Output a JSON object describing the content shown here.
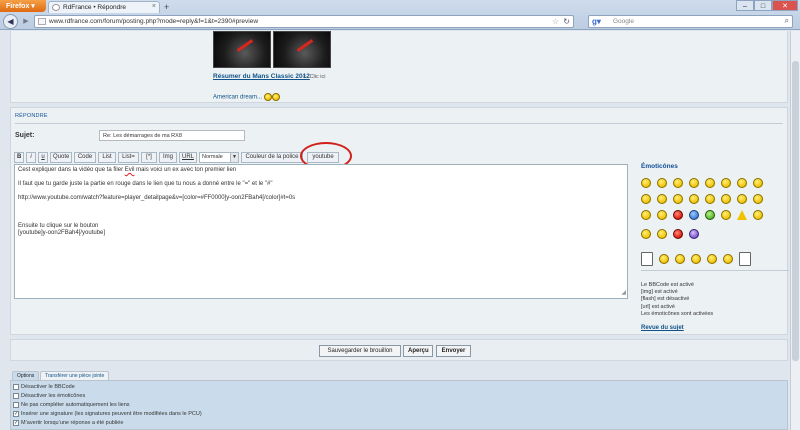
{
  "browser": {
    "app_button": "Firefox",
    "tab_title": "RdFrance • Répondre",
    "url": "www.rdfrance.com/forum/posting.php?mode=reply&f=1&t=2390#preview",
    "search_placeholder": "Google"
  },
  "preview": {
    "link_text": "Résumer du Mans Classic 2012",
    "credit": "<- Clic ici",
    "line2": "American dream..."
  },
  "reply": {
    "panel_title": "RÉPONDRE",
    "subject_label": "Sujet:",
    "subject_value": "Re: Les démarrages de ma RX8"
  },
  "toolbar": {
    "bold": "B",
    "italic": "i",
    "underline": "u",
    "quote": "Quote",
    "code": "Code",
    "list": "List",
    "list_ordered": "List=",
    "list_item": "[*]",
    "img": "Img",
    "url": "URL",
    "font_size": "Normale",
    "font_color": "Couleur de la police",
    "youtube": "youtube"
  },
  "editor": {
    "lines": [
      "Cest expliquer dans la vidéo que ta filer Evil mais voici un ex avec ton premier lien",
      "",
      "Il faut que tu garde juste la partie en rouge dans le lien que tu nous a donné entre le \"=\" et le \"#\"",
      "",
      "http://www.youtube.com/watch?feature=player_detailpage&v=[color=#FF0000]y-oon2FBah4[/color]#t=0s",
      "",
      "",
      "",
      "Ensuite tu clique sur le bouton",
      "[youtube]y-oon2FBah4[/youtube]"
    ]
  },
  "emoticons": {
    "title": "Émoticônes"
  },
  "bbcode_status": [
    "Le BBCode est activé",
    "[img] est activé",
    "[flash] est désactivé",
    "[url] est activé",
    "Les émoticônes sont activées"
  ],
  "review_link": "Revue du sujet",
  "buttons": {
    "save_draft": "Sauvegarder le brouillon",
    "preview": "Aperçu",
    "submit": "Envoyer"
  },
  "options": {
    "tabs": [
      "Options",
      "Transférer une pièce jointe"
    ],
    "items": [
      {
        "label": "Désactiver le BBCode",
        "checked": false
      },
      {
        "label": "Désactiver les émoticônes",
        "checked": false
      },
      {
        "label": "Ne pas compléter automatiquement les liens",
        "checked": false
      },
      {
        "label": "Insérer une signature (les signatures peuvent être modifiées dans le PCU)",
        "checked": true
      },
      {
        "label": "M’avertir lorsqu’une réponse a été publiée",
        "checked": true
      }
    ]
  },
  "colors": {
    "link": "#105289",
    "panel_bg": "#ecf1f3",
    "annotation_circle": "#d0211c"
  }
}
